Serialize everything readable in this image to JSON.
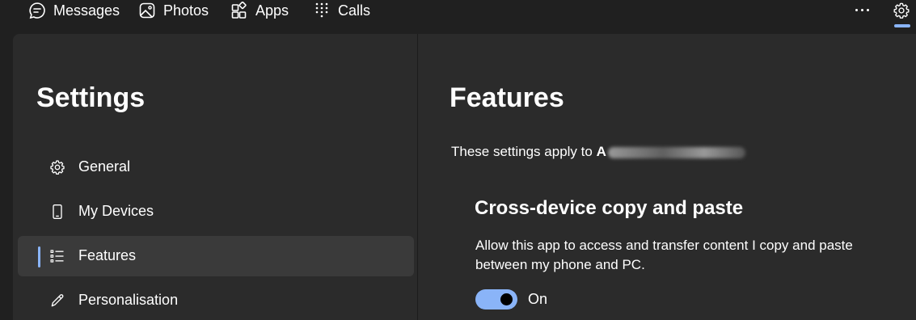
{
  "top_nav": {
    "tabs": [
      {
        "label": "Messages",
        "icon": "messages-icon"
      },
      {
        "label": "Photos",
        "icon": "photos-icon"
      },
      {
        "label": "Apps",
        "icon": "apps-icon"
      },
      {
        "label": "Calls",
        "icon": "dialpad-icon"
      }
    ],
    "more_icon": "more-icon",
    "settings_icon": "gear-icon"
  },
  "sidebar": {
    "title": "Settings",
    "items": [
      {
        "label": "General",
        "icon": "gear-icon",
        "selected": false
      },
      {
        "label": "My Devices",
        "icon": "phone-icon",
        "selected": false
      },
      {
        "label": "Features",
        "icon": "list-icon",
        "selected": true
      },
      {
        "label": "Personalisation",
        "icon": "pen-icon",
        "selected": false
      }
    ]
  },
  "content": {
    "title": "Features",
    "apply_prefix": "These settings apply to",
    "apply_initial": "A",
    "section": {
      "title": "Cross-device copy and paste",
      "description": "Allow this app to access and transfer content I copy and paste between my phone and PC.",
      "toggle_label": "On",
      "toggle_on": true
    }
  },
  "colors": {
    "accent": "#8ab4f8",
    "background": "#202020",
    "panel": "#2b2b2b",
    "selected_item": "#3a3a3a"
  }
}
